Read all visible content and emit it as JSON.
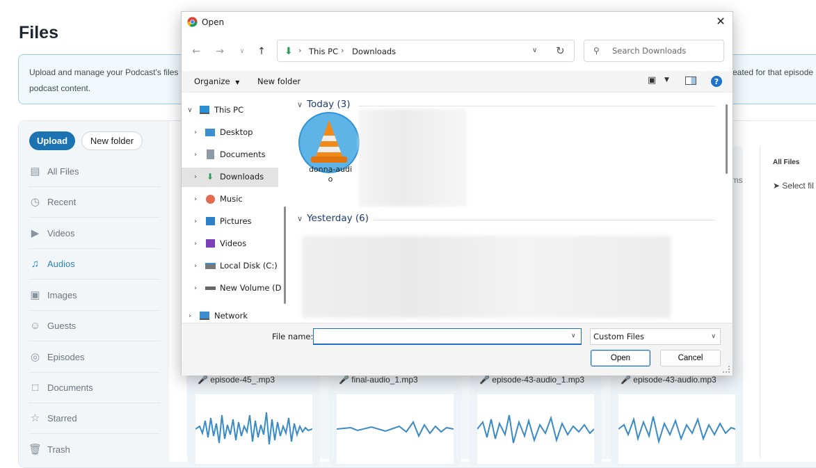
{
  "app": {
    "page_title": "Files",
    "banner": {
      "line1": "Upload and manage your Podcast's files or",
      "line2": "podcast content.",
      "line3": "reated for that episode"
    },
    "sidebar": {
      "upload_label": "Upload",
      "new_folder_label": "New folder",
      "items": [
        {
          "label": "All Files",
          "icon": "folder-icon"
        },
        {
          "label": "Recent",
          "icon": "clock-icon"
        },
        {
          "label": "Videos",
          "icon": "video-icon"
        },
        {
          "label": "Audios",
          "icon": "music-note-icon",
          "active": true
        },
        {
          "label": "Images",
          "icon": "image-icon"
        },
        {
          "label": "Guests",
          "icon": "users-icon"
        },
        {
          "label": "Episodes",
          "icon": "episodes-icon"
        },
        {
          "label": "Documents",
          "icon": "document-icon"
        },
        {
          "label": "Starred",
          "icon": "star-icon"
        },
        {
          "label": "Trash",
          "icon": "trash-icon"
        }
      ]
    },
    "right_panel": {
      "title": "All Files",
      "select_text": "Select fil"
    },
    "partial_text": "ems",
    "audio_cards": [
      {
        "name": "episode-45_.mp3"
      },
      {
        "name": "final-audio_1.mp3"
      },
      {
        "name": "episode-43-audio_1.mp3"
      },
      {
        "name": "episode-43-audio.mp3"
      }
    ],
    "accent_color": "#1b73b2"
  },
  "dialog": {
    "title": "Open",
    "breadcrumb": [
      "This PC",
      "Downloads"
    ],
    "search_placeholder": "Search Downloads",
    "toolbar": {
      "organize_label": "Organize",
      "new_folder_label": "New folder"
    },
    "nav_tree": [
      {
        "label": "This PC",
        "icon": "pc-icon",
        "expanded": true
      },
      {
        "label": "Desktop",
        "icon": "desktop-icon"
      },
      {
        "label": "Documents",
        "icon": "documents-icon"
      },
      {
        "label": "Downloads",
        "icon": "downloads-icon",
        "selected": true
      },
      {
        "label": "Music",
        "icon": "music-icon"
      },
      {
        "label": "Pictures",
        "icon": "pictures-icon"
      },
      {
        "label": "Videos",
        "icon": "videos-icon"
      },
      {
        "label": "Local Disk (C:)",
        "icon": "disk-icon"
      },
      {
        "label": "New Volume (D",
        "icon": "drive-icon"
      },
      {
        "label": "Network",
        "icon": "network-icon"
      }
    ],
    "groups": [
      {
        "label": "Today (3)"
      },
      {
        "label": "Yesterday (6)"
      }
    ],
    "file_item": {
      "name_line1": "donna-audi",
      "name_line2": "o",
      "icon": "vlc-cone-icon"
    },
    "file_name_label": "File name:",
    "file_name_value": "",
    "file_type_value": "Custom Files",
    "open_label": "Open",
    "cancel_label": "Cancel"
  }
}
